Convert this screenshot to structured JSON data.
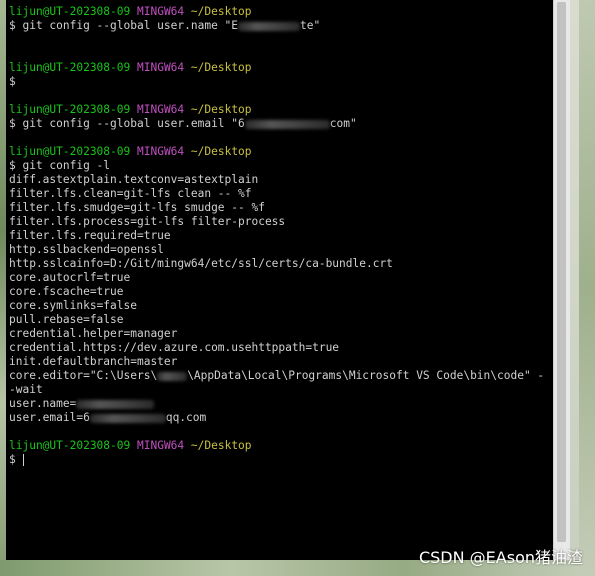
{
  "prompt": {
    "user": "lijun@UT-202308-09",
    "host": "MINGW64",
    "path": "~/Desktop"
  },
  "commands": {
    "cmd1_prefix": "$ git config --global user.name \"E",
    "cmd1_suffix": "te\"",
    "cmd2": "$",
    "cmd3_prefix": "$ git config --global user.email \"6",
    "cmd3_suffix": "com\"",
    "cmd4": "$ git config -l",
    "final_prompt": "$"
  },
  "config_output": [
    "diff.astextplain.textconv=astextplain",
    "filter.lfs.clean=git-lfs clean -- %f",
    "filter.lfs.smudge=git-lfs smudge -- %f",
    "filter.lfs.process=git-lfs filter-process",
    "filter.lfs.required=true",
    "http.sslbackend=openssl",
    "http.sslcainfo=D:/Git/mingw64/etc/ssl/certs/ca-bundle.crt",
    "core.autocrlf=true",
    "core.fscache=true",
    "core.symlinks=false",
    "pull.rebase=false",
    "credential.helper=manager",
    "credential.https://dev.azure.com.usehttppath=true",
    "init.defaultbranch=master"
  ],
  "editor_line": {
    "prefix": "core.editor=\"C:\\Users\\",
    "suffix": "\\AppData\\Local\\Programs\\Microsoft VS Code\\bin\\code\" -",
    "wrap": "-wait"
  },
  "user_lines": {
    "name_prefix": "user.name=",
    "email_prefix": "user.email=6",
    "email_suffix": "qq.com"
  },
  "watermark": "CSDN @EAson猪油渣",
  "colors": {
    "terminal_bg": "#000000",
    "text": "#d0d0d0",
    "prompt_user": "#19c419",
    "prompt_host": "#c050c0",
    "prompt_path": "#c8c040"
  }
}
